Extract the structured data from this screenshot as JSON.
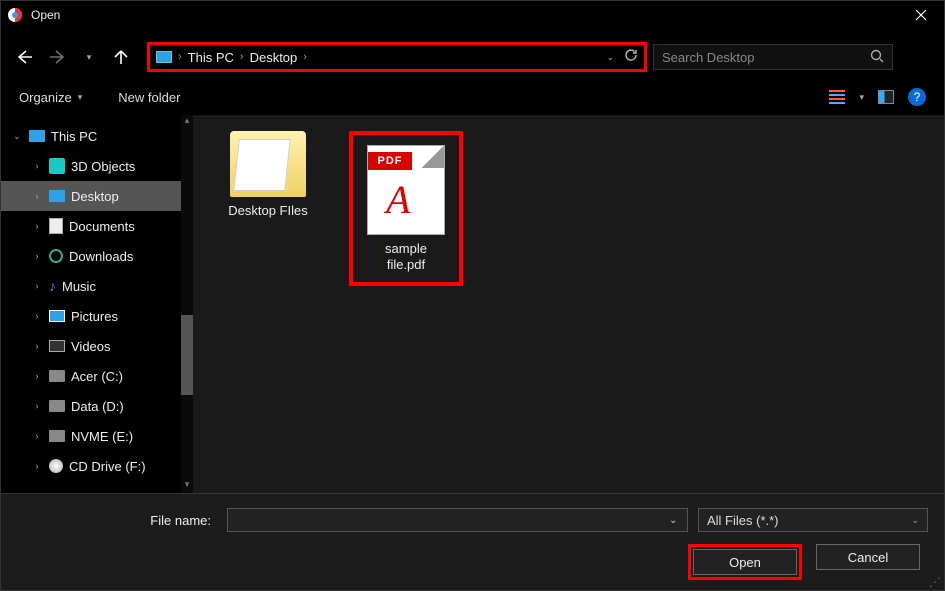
{
  "window": {
    "title": "Open"
  },
  "nav": {
    "breadcrumb": [
      "This PC",
      "Desktop"
    ],
    "search_placeholder": "Search Desktop"
  },
  "toolbar": {
    "organize": "Organize",
    "new_folder": "New folder"
  },
  "tree": {
    "root": "This PC",
    "items": [
      {
        "label": "3D Objects"
      },
      {
        "label": "Desktop",
        "selected": true
      },
      {
        "label": "Documents"
      },
      {
        "label": "Downloads"
      },
      {
        "label": "Music"
      },
      {
        "label": "Pictures"
      },
      {
        "label": "Videos"
      },
      {
        "label": "Acer (C:)"
      },
      {
        "label": "Data (D:)"
      },
      {
        "label": "NVME (E:)"
      },
      {
        "label": "CD Drive (F:)"
      }
    ]
  },
  "content": {
    "items": [
      {
        "type": "folder",
        "label": "Desktop FIles"
      },
      {
        "type": "pdf",
        "label_line1": "sample",
        "label_line2": "file.pdf",
        "badge": "PDF",
        "highlighted": true
      }
    ]
  },
  "footer": {
    "filename_label": "File name:",
    "filename_value": "",
    "filter_label": "All Files (*.*)",
    "open": "Open",
    "cancel": "Cancel"
  },
  "annotations": {
    "highlight_color": "#ff0000",
    "highlighted_regions": [
      "breadcrumb",
      "pdf-file",
      "open-button"
    ]
  }
}
